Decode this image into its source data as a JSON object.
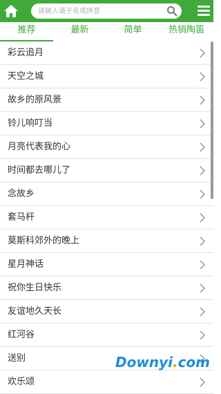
{
  "header": {
    "search_placeholder": "请输入谱子名或拼音",
    "bg_color": "#3faa3a"
  },
  "tabs": [
    {
      "label": "推荐",
      "active": true
    },
    {
      "label": "最新",
      "active": false
    },
    {
      "label": "简单",
      "active": false
    },
    {
      "label": "热销陶笛",
      "active": false
    }
  ],
  "songs": [
    "彩云追月",
    "天空之城",
    "故乡的原风景",
    "铃儿响叮当",
    "月亮代表我的心",
    "时间都去哪儿了",
    "念故乡",
    "套马杆",
    "莫斯科郊外的晚上",
    "星月神话",
    "祝你生日快乐",
    "友谊地久天长",
    "红河谷",
    "送别",
    "欢乐颂"
  ],
  "watermark": {
    "left": "Downyi",
    "dot": ".",
    "right": "com"
  },
  "icons": [
    "home-icon",
    "search-icon",
    "menu-icon",
    "chevron-right-icon"
  ]
}
